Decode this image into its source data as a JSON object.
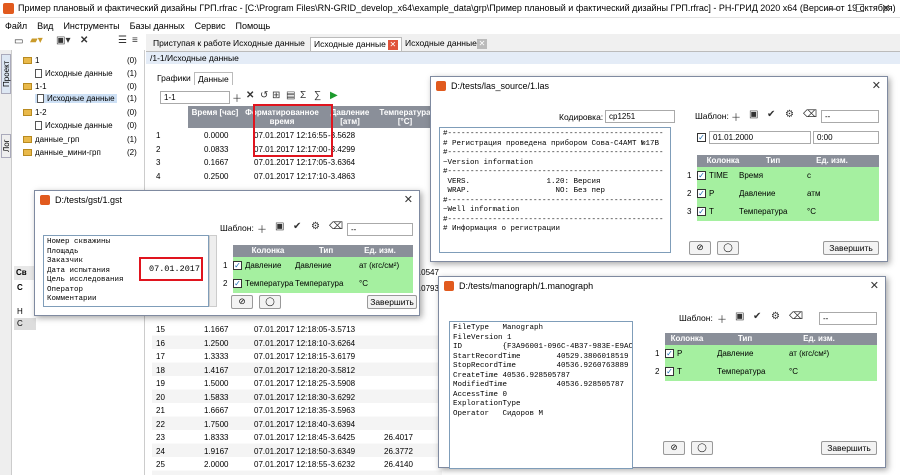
{
  "window": {
    "title": "Пример плановый и фактический дизайны ГРП.rfrac - [C:\\Program Files\\RN-GRID_develop_x64\\example_data\\grp\\Пример плановый и фактический дизайны ГРП.rfrac] - РН-ГРИД 2020 x64 (Версия от 19 октября)"
  },
  "menu": [
    "Файл",
    "Вид",
    "Инструменты",
    "Базы данных",
    "Сервис",
    "Помощь"
  ],
  "side_tabs": [
    "Проект",
    "Лог"
  ],
  "tree": [
    {
      "label": "1",
      "count": "(0)",
      "indent": 1,
      "icon": "folder-icon"
    },
    {
      "label": "Исходные данные",
      "count": "(1)",
      "indent": 2,
      "icon": "document-icon"
    },
    {
      "label": "1-1",
      "count": "(0)",
      "indent": 1,
      "icon": "folder-icon"
    },
    {
      "label": "Исходные данные",
      "count": "(1)",
      "indent": 2,
      "icon": "document-icon"
    },
    {
      "label": "1-2",
      "count": "(0)",
      "indent": 1,
      "icon": "folder-icon"
    },
    {
      "label": "Исходные данные",
      "count": "(0)",
      "indent": 2,
      "icon": "document-icon"
    },
    {
      "label": "данные_грп",
      "count": "(1)",
      "indent": 1,
      "icon": "folder-icon"
    },
    {
      "label": "данные_мини-грп",
      "count": "(2)",
      "indent": 1,
      "icon": "folder-icon"
    }
  ],
  "tabs": [
    "Приступая к работе",
    "Исходные данные",
    "Исходные данные",
    "Исходные данные"
  ],
  "breadcrumb": "/1-1/Исходные данные",
  "subtabs": [
    "Графики",
    "Данные"
  ],
  "grid": {
    "selector": "1-1",
    "headers": [
      "Время [час]",
      "Форматированное время",
      "Давление [атм]",
      "Температура [°С]"
    ],
    "rows": [
      [
        "1",
        "0.0000",
        "07.01.2017 12:16:55",
        "-3.5628",
        ""
      ],
      [
        "2",
        "0.0833",
        "07.01.2017 12:17:00",
        "-3.4299",
        ""
      ],
      [
        "3",
        "0.1667",
        "07.01.2017 12:17:05",
        "-3.6364",
        ""
      ],
      [
        "4",
        "0.2500",
        "07.01.2017 12:17:10",
        "-3.4863",
        ""
      ],
      [
        "15",
        "1.1667",
        "07.01.2017 12:18:05",
        "-3.5713",
        ""
      ],
      [
        "16",
        "1.2500",
        "07.01.2017 12:18:10",
        "-3.6264",
        ""
      ],
      [
        "17",
        "1.3333",
        "07.01.2017 12:18:15",
        "-3.6179",
        ""
      ],
      [
        "18",
        "1.4167",
        "07.01.2017 12:18:20",
        "-3.5812",
        ""
      ],
      [
        "19",
        "1.5000",
        "07.01.2017 12:18:25",
        "-3.5908",
        ""
      ],
      [
        "20",
        "1.5833",
        "07.01.2017 12:18:30",
        "-3.6292",
        ""
      ],
      [
        "21",
        "1.6667",
        "07.01.2017 12:18:35",
        "-3.5963",
        ""
      ],
      [
        "22",
        "1.7500",
        "07.01.2017 12:18:40",
        "-3.6394",
        ""
      ],
      [
        "23",
        "1.8333",
        "07.01.2017 12:18:45",
        "-3.6425",
        "26.4017"
      ],
      [
        "24",
        "1.9167",
        "07.01.2017 12:18:50",
        "-3.6349",
        "26.3772"
      ],
      [
        "25",
        "2.0000",
        "07.01.2017 12:18:55",
        "-3.6232",
        "26.4140"
      ]
    ],
    "partial_right": [
      "26.0547",
      "26.0793"
    ],
    "side_fragments": [
      "Св",
      "С",
      "Н",
      "С"
    ]
  },
  "gst": {
    "title": "D:/tests/gst/1.gst",
    "lines": [
      "Номер скважины",
      "Площадь",
      "Заказчик",
      "Дата испытания",
      "Цель исследования",
      "Оператор",
      "Комментарии"
    ],
    "date_value": "07.01.2017",
    "template_label": "Шаблон:",
    "template_value": "--",
    "cols": [
      "Колонка",
      "Тип",
      "Ед. изм."
    ],
    "rows": [
      {
        "n": "1",
        "col": "Давление",
        "type": "Давление",
        "unit": "ат (кгс/см²)"
      },
      {
        "n": "2",
        "col": "Температура",
        "type": "Температура",
        "unit": "°С"
      }
    ],
    "finish": "Завершить"
  },
  "las": {
    "title": "D:/tests/las_source/1.las",
    "encoding_label": "Кодировка:",
    "encoding": "cp1251",
    "lines": [
      "#------------------------------------------------",
      "# Регистрация проведена прибором Сова-С4АМТ №17В",
      "#------------------------------------------------",
      "~Version information",
      "#------------------------------------------------",
      " VERS.                 1.20: Версия",
      " WRAP.                   NO: Без пер",
      "#------------------------------------------------",
      "~Well information",
      "#------------------------------------------------",
      "# Информация о регистрации"
    ],
    "template_label": "Шаблон:",
    "template_value": "--",
    "date": "01.01.2000",
    "time": "0:00",
    "cols": [
      "Колонка",
      "Тип",
      "Ед. изм."
    ],
    "rows": [
      {
        "n": "1",
        "col": "TIME",
        "type": "Время",
        "unit": "с"
      },
      {
        "n": "2",
        "col": "P",
        "type": "Давление",
        "unit": "атм"
      },
      {
        "n": "3",
        "col": "T",
        "type": "Температура",
        "unit": "°С"
      }
    ],
    "finish": "Завершить"
  },
  "mano": {
    "title": "D:/tests/manograph/1.manograph",
    "lines": [
      "FileType   Manograph",
      "FileVersion 1",
      "ID         {F3A96001-096C-4B37-983E-E9AC",
      "StartRecordTime        40529.3806018519",
      "StopRecordTime         40536.9260763889",
      "CreateTime 40536.928505787",
      "ModifiedTime           40536.928505787",
      "AccessTime 0",
      "ExplorationType",
      "Operator   Сидоров М"
    ],
    "template_label": "Шаблон:",
    "template_value": "--",
    "cols": [
      "Колонка",
      "Тип",
      "Ед. изм."
    ],
    "rows": [
      {
        "n": "1",
        "col": "P",
        "type": "Давление",
        "unit": "ат (кгс/см²)"
      },
      {
        "n": "2",
        "col": "T",
        "type": "Температура",
        "unit": "°С"
      }
    ],
    "finish": "Завершить"
  },
  "colors": {
    "header": "#8a8f99",
    "row_green": "#a5f0a0",
    "highlight": "#e0141e"
  }
}
